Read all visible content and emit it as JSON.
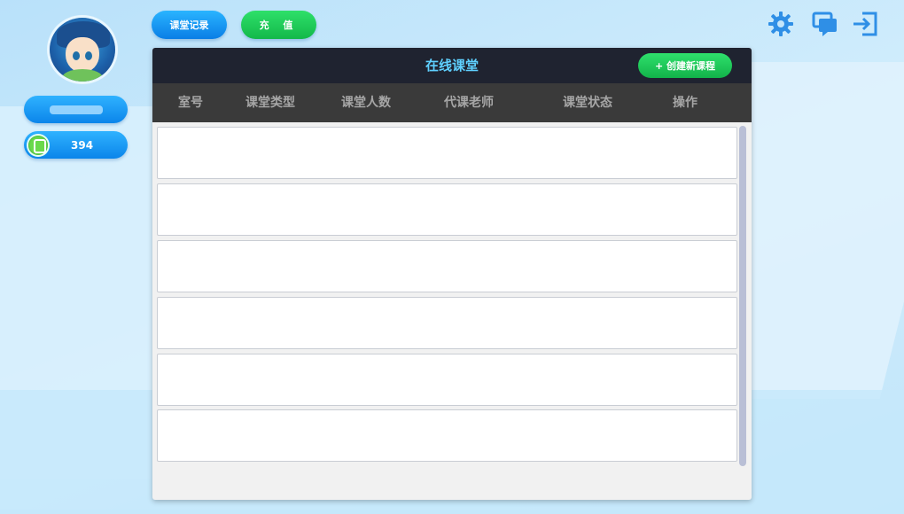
{
  "buttons": {
    "record": "课堂记录",
    "charge": "充 值",
    "create_course": "+ 创建新课程"
  },
  "user": {
    "coins": "394"
  },
  "icons": {
    "settings": "gear-icon",
    "messages": "chat-icon",
    "logout": "exit-icon",
    "coin": "coin-icon"
  },
  "panel": {
    "title": "在线课堂",
    "columns": [
      "室号",
      "课堂类型",
      "课堂人数",
      "代课老师",
      "课堂状态",
      "操作"
    ]
  },
  "colors": {
    "accent_blue": "#0b85ea",
    "accent_green": "#13b84a",
    "title_cyan": "#5fd0ff",
    "header_dark": "#1f2330"
  }
}
